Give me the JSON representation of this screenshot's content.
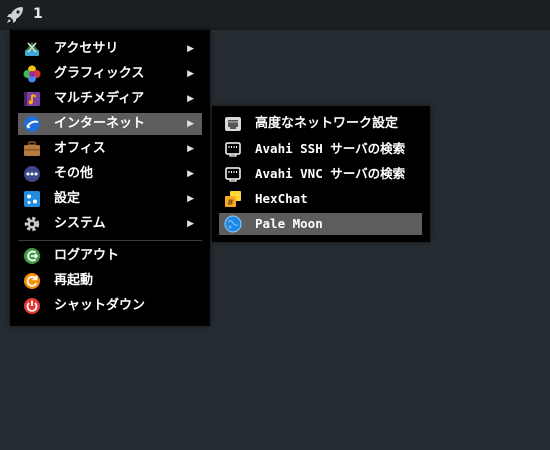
{
  "topbar": {
    "workspace": "1"
  },
  "main_menu": {
    "items": [
      {
        "label": "アクセサリ",
        "icon": "accessories-icon",
        "has_submenu": true
      },
      {
        "label": "グラフィックス",
        "icon": "graphics-icon",
        "has_submenu": true
      },
      {
        "label": "マルチメディア",
        "icon": "multimedia-icon",
        "has_submenu": true
      },
      {
        "label": "インターネット",
        "icon": "internet-icon",
        "has_submenu": true,
        "highlighted": true
      },
      {
        "label": "オフィス",
        "icon": "office-icon",
        "has_submenu": true
      },
      {
        "label": "その他",
        "icon": "other-icon",
        "has_submenu": true
      },
      {
        "label": "設定",
        "icon": "settings-icon",
        "has_submenu": true
      },
      {
        "label": "システム",
        "icon": "system-icon",
        "has_submenu": true
      }
    ],
    "actions": [
      {
        "label": "ログアウト",
        "icon": "logout-icon"
      },
      {
        "label": "再起動",
        "icon": "reboot-icon"
      },
      {
        "label": "シャットダウン",
        "icon": "shutdown-icon"
      }
    ],
    "arrow_glyph": "▶"
  },
  "sub_menu": {
    "items": [
      {
        "label": "高度なネットワーク設定",
        "icon": "network-settings-icon"
      },
      {
        "label": "Avahi SSH サーバの検索",
        "icon": "avahi-ssh-icon"
      },
      {
        "label": "Avahi VNC サーバの検索",
        "icon": "avahi-vnc-icon"
      },
      {
        "label": "HexChat",
        "icon": "hexchat-icon"
      },
      {
        "label": "Pale Moon",
        "icon": "pale-moon-icon",
        "highlighted": true
      }
    ]
  },
  "colors": {
    "desktop": "#262d32",
    "menu_bg": "#000000",
    "highlight": "#5d5d5d"
  }
}
